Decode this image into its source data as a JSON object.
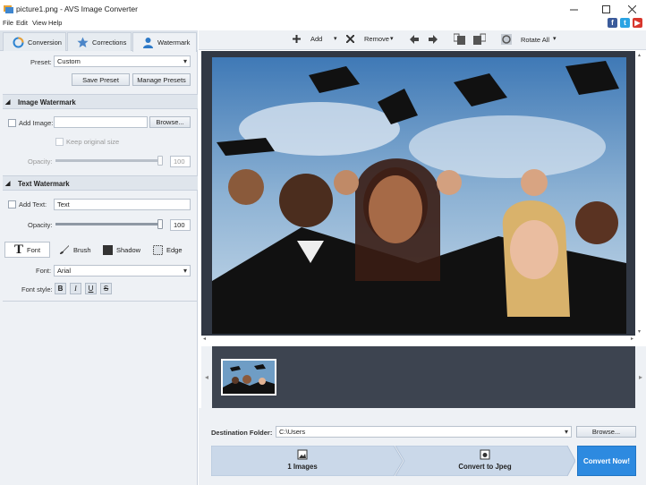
{
  "window": {
    "title": "picture1.png - AVS Image Converter"
  },
  "menu": [
    "File",
    "Edit",
    "View",
    "Help"
  ],
  "tabs": [
    {
      "label": "Conversion",
      "icon": "conversion-icon"
    },
    {
      "label": "Corrections",
      "icon": "star-icon"
    },
    {
      "label": "Watermark",
      "icon": "user-icon"
    }
  ],
  "preset": {
    "label": "Preset:",
    "value": "Custom",
    "save_label": "Save Preset",
    "manage_label": "Manage Presets"
  },
  "image_watermark": {
    "title": "Image Watermark",
    "add_label": "Add Image:",
    "browse_label": "Browse...",
    "keep_label": "Keep original size",
    "opacity_label": "Opacity:",
    "opacity_value": "100"
  },
  "text_watermark": {
    "title": "Text Watermark",
    "add_label": "Add Text:",
    "text_value": "Text",
    "opacity_label": "Opacity:",
    "opacity_value": "100"
  },
  "style_tabs": {
    "font": "Font",
    "brush": "Brush",
    "shadow": "Shadow",
    "edge": "Edge"
  },
  "font": {
    "label": "Font:",
    "value": "Arial",
    "style_label": "Font style:",
    "styles": [
      "B",
      "I",
      "U",
      "S"
    ]
  },
  "toolbar": {
    "add_label": "Add",
    "remove_label": "Remove",
    "rotate_label": "Rotate All"
  },
  "destination": {
    "label": "Destination Folder:",
    "path": "C:\\Users",
    "browse_label": "Browse..."
  },
  "steps": {
    "images_label": "1 Images",
    "convert_label": "Convert to Jpeg",
    "convert_now_label": "Convert Now!"
  },
  "colors": {
    "accent": "#2d8ae0",
    "panel_bg": "#eef1f5",
    "viewer_bg": "#313844"
  }
}
